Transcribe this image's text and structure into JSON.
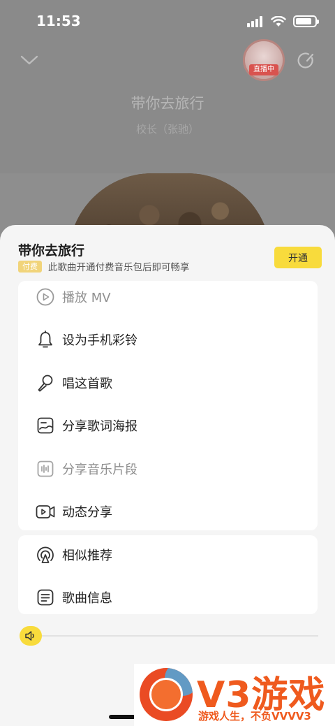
{
  "status_bar": {
    "time": "11:53"
  },
  "player": {
    "song_title": "带你去旅行",
    "artist": "校长（张驰）",
    "live_badge": "直播中"
  },
  "sheet": {
    "title": "带你去旅行",
    "paid_tag": "付费",
    "paid_hint": "此歌曲开通付费音乐包后即可畅享",
    "open_button": "开通"
  },
  "menu": {
    "items": [
      {
        "label": "播放 MV",
        "icon": "play-mv-icon",
        "disabled": true
      },
      {
        "label": "设为手机彩铃",
        "icon": "bell-icon",
        "disabled": false
      },
      {
        "label": "唱这首歌",
        "icon": "microphone-icon",
        "disabled": false
      },
      {
        "label": "分享歌词海报",
        "icon": "lyrics-poster-icon",
        "disabled": false
      },
      {
        "label": "分享音乐片段",
        "icon": "waveform-icon",
        "disabled": true
      },
      {
        "label": "动态分享",
        "icon": "video-camera-icon",
        "disabled": false
      }
    ],
    "secondary": [
      {
        "label": "相似推荐",
        "icon": "radio-recommend-icon"
      },
      {
        "label": "歌曲信息",
        "icon": "document-info-icon"
      }
    ]
  },
  "volume": {
    "icon": "speaker-icon",
    "level": 0
  },
  "watermark": {
    "brand": "V3游戏",
    "slogan": "游戏人生，不负VVVV3"
  },
  "colors": {
    "accent": "#f8db3c",
    "paid_tag": "#f1d47a",
    "watermark": "#ef5a1e"
  }
}
